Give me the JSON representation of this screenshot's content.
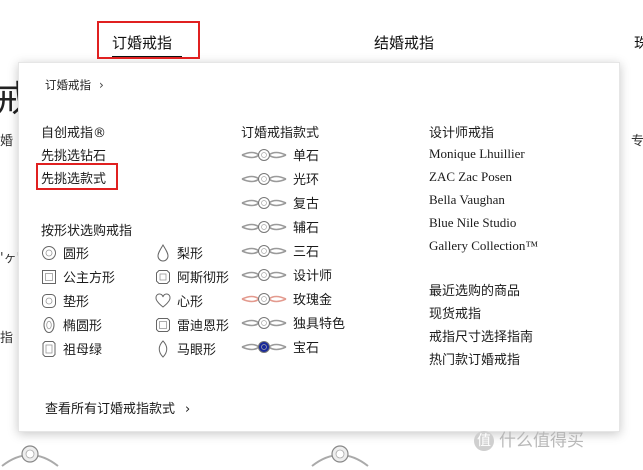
{
  "topnav": {
    "tabs": [
      {
        "label": "订婚戒指",
        "active": true
      },
      {
        "label": "结婚戒指",
        "active": false
      },
      {
        "label": "珠",
        "active": false
      }
    ]
  },
  "background": {
    "big_char": "戒",
    "frag_left": [
      "婚",
      "指",
      "'ヶ' ヲ"
    ],
    "frag_right": "专"
  },
  "dropdown": {
    "breadcrumb": {
      "label": "订婚戒指",
      "chevron": "›"
    },
    "col1": {
      "custom_title": "自创戒指®",
      "pick_diamond": "先挑选钻石",
      "pick_style": "先挑选款式",
      "shape_title": "按形状选购戒指",
      "shapes": [
        {
          "label": "圆形",
          "icon": "round-icon"
        },
        {
          "label": "梨形",
          "icon": "pear-icon"
        },
        {
          "label": "公主方形",
          "icon": "princess-icon"
        },
        {
          "label": "阿斯彻形",
          "icon": "asscher-icon"
        },
        {
          "label": "垫形",
          "icon": "cushion-icon"
        },
        {
          "label": "心形",
          "icon": "heart-icon"
        },
        {
          "label": "椭圆形",
          "icon": "oval-icon"
        },
        {
          "label": "雷迪恩形",
          "icon": "radiant-icon"
        },
        {
          "label": "祖母绿",
          "icon": "emerald-icon"
        },
        {
          "label": "马眼形",
          "icon": "marquise-icon"
        }
      ],
      "view_all": "查看所有订婚戒指款式",
      "view_all_chevron": "›"
    },
    "col2": {
      "title": "订婚戒指款式",
      "styles": [
        {
          "label": "单石",
          "color": "#9a9a9a",
          "stone": "#ffffff"
        },
        {
          "label": "光环",
          "color": "#9a9a9a",
          "stone": "#ffffff"
        },
        {
          "label": "复古",
          "color": "#9a9a9a",
          "stone": "#ffffff"
        },
        {
          "label": "辅石",
          "color": "#9a9a9a",
          "stone": "#ffffff"
        },
        {
          "label": "三石",
          "color": "#9a9a9a",
          "stone": "#ffffff"
        },
        {
          "label": "设计师",
          "color": "#9a9a9a",
          "stone": "#ffffff"
        },
        {
          "label": "玫瑰金",
          "color": "#e39a8e",
          "stone": "#ffffff"
        },
        {
          "label": "独具特色",
          "color": "#9a9a9a",
          "stone": "#ffffff"
        },
        {
          "label": "宝石",
          "color": "#9a9a9a",
          "stone": "#1a2a9a"
        }
      ]
    },
    "col3": {
      "designer_title": "设计师戒指",
      "designers": [
        "Monique Lhuillier",
        "ZAC Zac Posen",
        "Bella Vaughan",
        "Blue Nile Studio",
        "Gallery Collection™"
      ],
      "links": [
        "最近选购的商品",
        "现货戒指",
        "戒指尺寸选择指南",
        "热门款订婚戒指"
      ]
    }
  },
  "watermark": {
    "icon": "值",
    "text": "什么值得买"
  }
}
